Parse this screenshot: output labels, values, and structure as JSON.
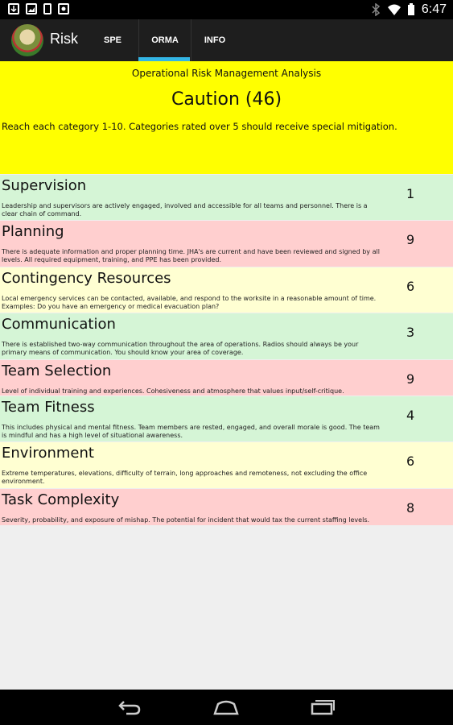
{
  "status_bar": {
    "left_icons": [
      "download-icon",
      "image-icon",
      "phone-icon",
      "camera-icon"
    ],
    "right_icons": [
      "bluetooth-icon",
      "wifi-icon",
      "battery-icon"
    ],
    "time": "6:47"
  },
  "action_bar": {
    "title": "Risk",
    "tabs": [
      {
        "label": "SPE",
        "selected": false
      },
      {
        "label": "ORMA",
        "selected": true
      },
      {
        "label": "INFO",
        "selected": false
      }
    ],
    "accent_color": "#33b5e5"
  },
  "header": {
    "subtitle": "Operational Risk Management Analysis",
    "result": "Caution (46)",
    "instructions": "Reach each category 1-10. Categories rated over 5 should receive special mitigation.",
    "background": "#ffff00"
  },
  "categories": [
    {
      "title": "Supervision",
      "description": "Leadership and supervisors are actively engaged, involved and accessible for all teams and personnel. There is a clear chain of command.",
      "score": "1",
      "level": "green"
    },
    {
      "title": "Planning",
      "description": "There is adequate information and proper planning time. JHA's are current and have been reviewed and signed by all levels. All required equipment, training, and PPE has been provided.",
      "score": "9",
      "level": "red"
    },
    {
      "title": "Contingency Resources",
      "description": "Local emergency services can be contacted, available, and respond to the worksite in a reasonable amount of time. Examples: Do you have an emergency or medical evacuation plan?",
      "score": "6",
      "level": "yellow"
    },
    {
      "title": "Communication",
      "description": "There is established two-way communication throughout the area of operations. Radios should always be your primary means of communication. You should know your area of coverage.",
      "score": "3",
      "level": "green"
    },
    {
      "title": "Team Selection",
      "description": "Level of individual training and experiences. Cohesiveness and atmosphere that values input/self-critique.",
      "score": "9",
      "level": "red"
    },
    {
      "title": "Team Fitness",
      "description": "This includes physical and mental fitness. Team members are rested, engaged, and overall morale is good. The team is mindful and has a high level of situational awareness.",
      "score": "4",
      "level": "green"
    },
    {
      "title": "Environment",
      "description": "Extreme temperatures, elevations, difficulty of terrain, long approaches and remoteness, not excluding the office environment.",
      "score": "6",
      "level": "yellow"
    },
    {
      "title": "Task Complexity",
      "description": "Severity, probability, and exposure of mishap. The potential for incident that would tax the current staffing levels.",
      "score": "8",
      "level": "red"
    }
  ],
  "nav_bar": {
    "buttons": [
      "back-icon",
      "home-icon",
      "recent-apps-icon"
    ]
  }
}
